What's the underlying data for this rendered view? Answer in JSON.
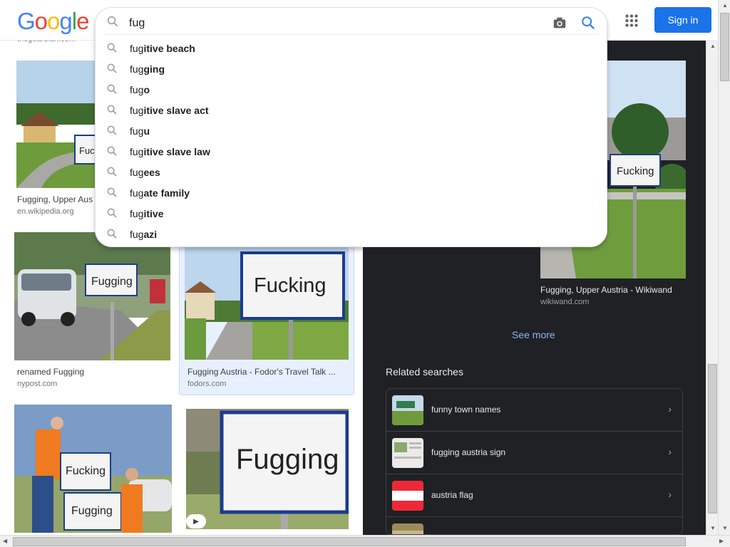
{
  "header": {
    "logo_letters": [
      "G",
      "o",
      "o",
      "g",
      "l",
      "e"
    ],
    "logo_colors": [
      "#4285f4",
      "#ea4335",
      "#fbbc05",
      "#4285f4",
      "#34a853",
      "#ea4335"
    ],
    "signin_label": "Sign in",
    "settings_icon": "gear-icon",
    "apps_icon": "apps-grid-icon"
  },
  "search": {
    "query": "fug",
    "camera_icon": "camera-icon",
    "suggestions": [
      {
        "prefix": "fug",
        "rest": "itive beach"
      },
      {
        "prefix": "fug",
        "rest": "ging"
      },
      {
        "prefix": "fug",
        "rest": "o"
      },
      {
        "prefix": "fug",
        "rest": "itive slave act"
      },
      {
        "prefix": "fug",
        "rest": "u"
      },
      {
        "prefix": "fug",
        "rest": "itive slave law"
      },
      {
        "prefix": "fug",
        "rest": "ees"
      },
      {
        "prefix": "fug",
        "rest": "ate family"
      },
      {
        "prefix": "fug",
        "rest": "itive"
      },
      {
        "prefix": "fug",
        "rest": "azi"
      }
    ]
  },
  "results": {
    "partial_source": "theguardian.com",
    "items": [
      {
        "caption": "Fugging, Upper Aus",
        "source": "en.wikipedia.org",
        "sign": "Fuck"
      },
      {
        "caption": "renamed Fugging",
        "source": "nypost.com",
        "sign": "Fugging"
      },
      {
        "caption": "Fugging Austria - Fodor's Travel Talk ...",
        "source": "fodors.com",
        "sign": "Fucking"
      },
      {
        "caption": "",
        "source": "",
        "sign": "Fucking"
      },
      {
        "caption": "",
        "source": "",
        "sign": "Fugging"
      }
    ],
    "extra_sign": "Fugging",
    "play_icon": "play-icon"
  },
  "preview": {
    "image_sign": "Fucking",
    "title": "Fugging, Upper Austria - Wikiwand",
    "source": "wikiwand.com",
    "see_more": "See more",
    "related_heading": "Related searches",
    "related": [
      {
        "label": "funny town names"
      },
      {
        "label": "fugging austria sign"
      },
      {
        "label": "austria flag"
      },
      {
        "label": ""
      }
    ],
    "flag_colors": [
      "#ed2939",
      "#ffffff",
      "#ed2939"
    ]
  }
}
